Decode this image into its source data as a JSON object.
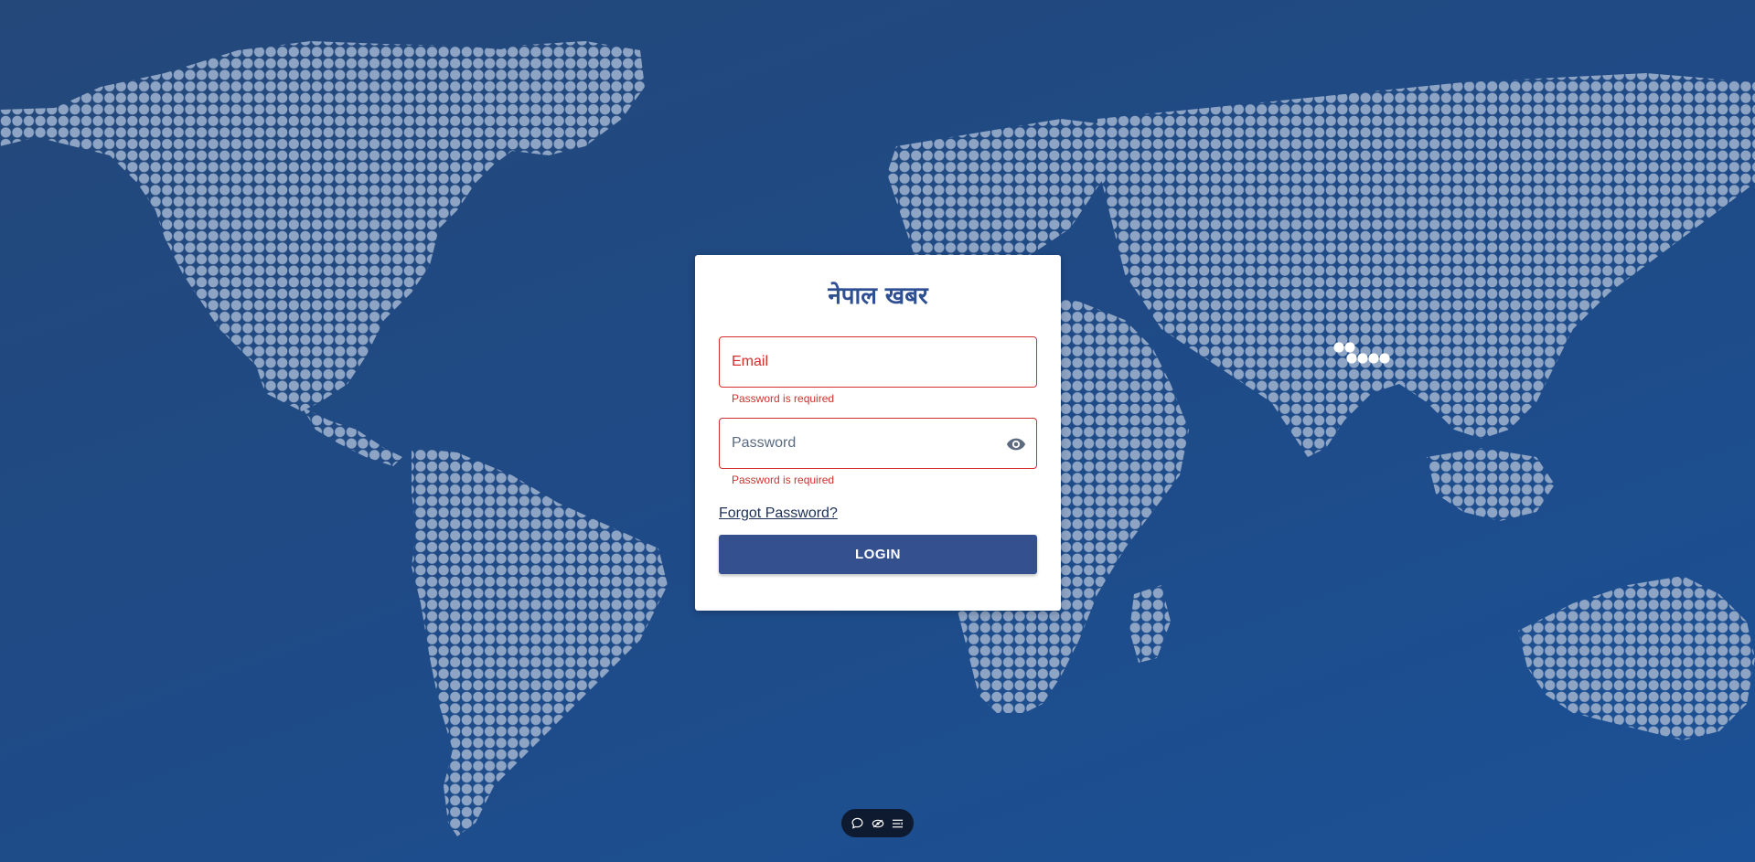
{
  "app": {
    "title": "नेपाल खबर"
  },
  "login_form": {
    "email": {
      "placeholder": "Email",
      "value": "",
      "helper_text": "Password is required"
    },
    "password": {
      "placeholder": "Password",
      "value": "",
      "helper_text": "Password is required",
      "toggle_icon": "eye-icon"
    },
    "forgot_password_label": "Forgot Password?",
    "login_label": "LOGIN"
  },
  "toolbar": {
    "icons": [
      "chat-icon",
      "eye-off-icon",
      "list-icon"
    ]
  },
  "colors": {
    "background": "#1f4a85",
    "map_dot": "#8ea4c4",
    "highlight_dot": "#ffffff",
    "brand": "#2f4f93",
    "error": "#d32f2f",
    "button": "#34508f"
  }
}
